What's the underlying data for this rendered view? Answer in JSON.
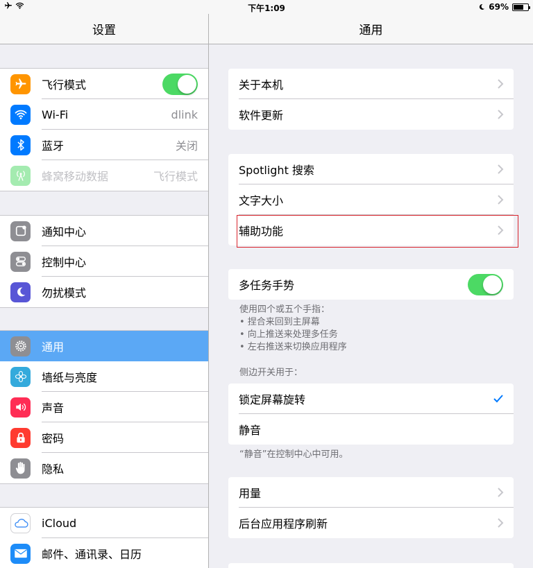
{
  "status": {
    "time": "下午1:09",
    "battery": "69%",
    "battery_level": 0.69
  },
  "sidebar": {
    "title": "设置",
    "groups": [
      [
        {
          "label": "飞行模式",
          "icon": "airplane-icon",
          "color": "#ff9500",
          "toggle": true
        },
        {
          "label": "Wi-Fi",
          "icon": "wifi-icon",
          "color": "#007aff",
          "value": "dlink"
        },
        {
          "label": "蓝牙",
          "icon": "bluetooth-icon",
          "color": "#007aff",
          "value": "关闭"
        },
        {
          "label": "蜂窝移动数据",
          "icon": "cellular-icon",
          "color": "#4cd964",
          "value": "飞行模式",
          "dim": true
        }
      ],
      [
        {
          "label": "通知中心",
          "icon": "notification-icon",
          "color": "#8e8e93"
        },
        {
          "label": "控制中心",
          "icon": "control-center-icon",
          "color": "#8e8e93"
        },
        {
          "label": "勿扰模式",
          "icon": "moon-icon",
          "color": "#5856d6"
        }
      ],
      [
        {
          "label": "通用",
          "icon": "gear-icon",
          "color": "#8e8e93",
          "selected": true
        },
        {
          "label": "墙纸与亮度",
          "icon": "flower-icon",
          "color": "#34aadc"
        },
        {
          "label": "声音",
          "icon": "speaker-icon",
          "color": "#ff2d55"
        },
        {
          "label": "密码",
          "icon": "lock-icon",
          "color": "#ff3b30"
        },
        {
          "label": "隐私",
          "icon": "hand-icon",
          "color": "#8e8e93"
        }
      ],
      [
        {
          "label": "iCloud",
          "icon": "cloud-icon",
          "color": "#ffffff"
        },
        {
          "label": "邮件、通讯录、日历",
          "icon": "mail-icon",
          "color": "#1d8cf8"
        }
      ]
    ]
  },
  "general": {
    "title": "通用",
    "about": "关于本机",
    "software_update": "软件更新",
    "spotlight": "Spotlight 搜索",
    "text_size": "文字大小",
    "accessibility": "辅助功能",
    "multitasking": "多任务手势",
    "multitasking_note": [
      "使用四个或五个手指：",
      "• 捏合来回到主屏幕",
      "• 向上推送来处理多任务",
      "• 左右推送来切换应用程序"
    ],
    "side_switch_header": "侧边开关用于：",
    "lock_rotation": "锁定屏幕旋转",
    "mute": "静音",
    "mute_note": "“静音”在控制中心中可用。",
    "usage": "用量",
    "background_refresh": "后台应用程序刷新"
  },
  "colors": {
    "accent": "#007aff",
    "toggle_on": "#4cd964",
    "selected_row": "#5ba8f5",
    "highlight_box": "#d9242c"
  }
}
